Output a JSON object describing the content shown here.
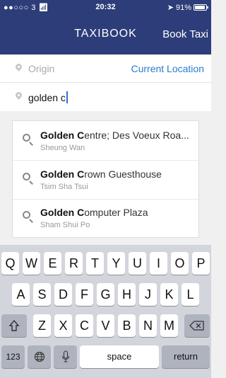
{
  "status_bar": {
    "carrier": "●●○○○ 3",
    "time": "20:32",
    "battery_pct": "91%",
    "battery_level": 0.91
  },
  "nav": {
    "title": "TAXIBOOK",
    "action_label": "Book Taxi"
  },
  "form": {
    "origin_placeholder": "Origin",
    "current_location_label": "Current Location",
    "destination_value": "golden c"
  },
  "suggestions": [
    {
      "bold": "Golden C",
      "rest": "entre; Des Voeux Roa...",
      "area": "Sheung Wan"
    },
    {
      "bold": "Golden C",
      "rest": "rown Guesthouse",
      "area": "Tsim Sha Tsui"
    },
    {
      "bold": "Golden C",
      "rest": "omputer Plaza",
      "area": "Sham Shui Po"
    }
  ],
  "keyboard": {
    "row1": [
      "Q",
      "W",
      "E",
      "R",
      "T",
      "Y",
      "U",
      "I",
      "O",
      "P"
    ],
    "row2": [
      "A",
      "S",
      "D",
      "F",
      "G",
      "H",
      "J",
      "K",
      "L"
    ],
    "row3": [
      "Z",
      "X",
      "C",
      "V",
      "B",
      "N",
      "M"
    ],
    "numbers_label": "123",
    "space_label": "space",
    "return_label": "return",
    "icons": {
      "shift": "shift-icon",
      "delete": "delete-icon",
      "globe": "globe-icon",
      "mic": "microphone-icon"
    }
  }
}
